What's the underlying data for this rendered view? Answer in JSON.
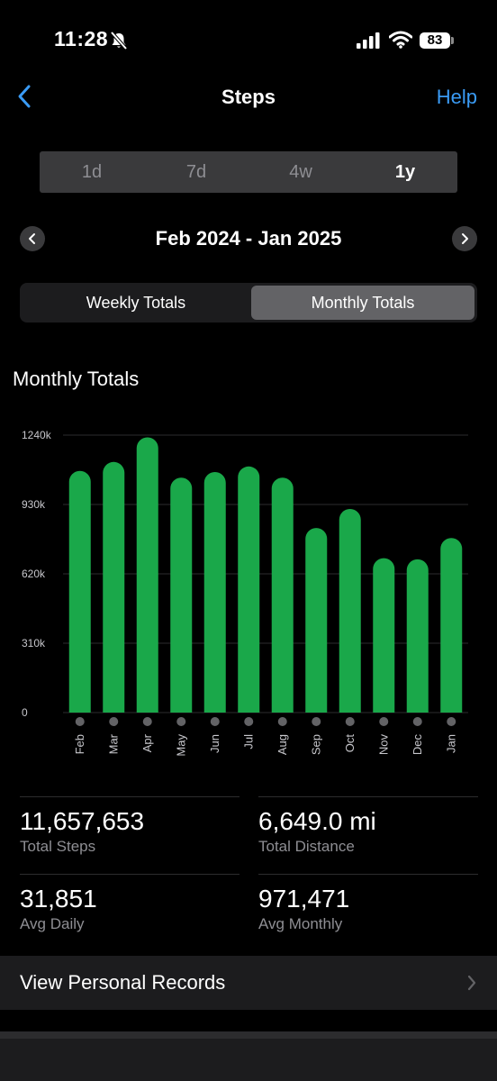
{
  "status_bar": {
    "time": "11:28",
    "battery": "83"
  },
  "nav": {
    "title": "Steps",
    "help_label": "Help"
  },
  "periods": [
    "1d",
    "7d",
    "4w",
    "1y"
  ],
  "selected_period": "1y",
  "date_range": "Feb 2024 - Jan 2025",
  "toggle": {
    "weekly_label": "Weekly Totals",
    "monthly_label": "Monthly Totals",
    "selected": "Monthly Totals"
  },
  "section_title": "Monthly Totals",
  "chart_data": {
    "type": "bar",
    "categories": [
      "Feb",
      "Mar",
      "Apr",
      "May",
      "Jun",
      "Jul",
      "Aug",
      "Sep",
      "Oct",
      "Nov",
      "Dec",
      "Jan"
    ],
    "values": [
      1080000,
      1120000,
      1230000,
      1050000,
      1075000,
      1100000,
      1050000,
      825000,
      910000,
      690000,
      685000,
      780000
    ],
    "yticks": [
      "0",
      "310k",
      "620k",
      "930k",
      "1240k"
    ],
    "ytick_values": [
      0,
      310000,
      620000,
      930000,
      1240000
    ],
    "ylim": [
      0,
      1240000
    ],
    "bar_color": "#1aa84a",
    "grid": true
  },
  "stats": {
    "total_steps": {
      "value": "11,657,653",
      "label": "Total Steps"
    },
    "total_distance": {
      "value": "6,649.0 mi",
      "label": "Total Distance"
    },
    "avg_daily": {
      "value": "31,851",
      "label": "Avg Daily"
    },
    "avg_monthly": {
      "value": "971,471",
      "label": "Avg Monthly"
    }
  },
  "records_label": "View Personal Records",
  "colors": {
    "accent": "#3a9bf5",
    "bar": "#1aa84a",
    "background": "#000000"
  }
}
